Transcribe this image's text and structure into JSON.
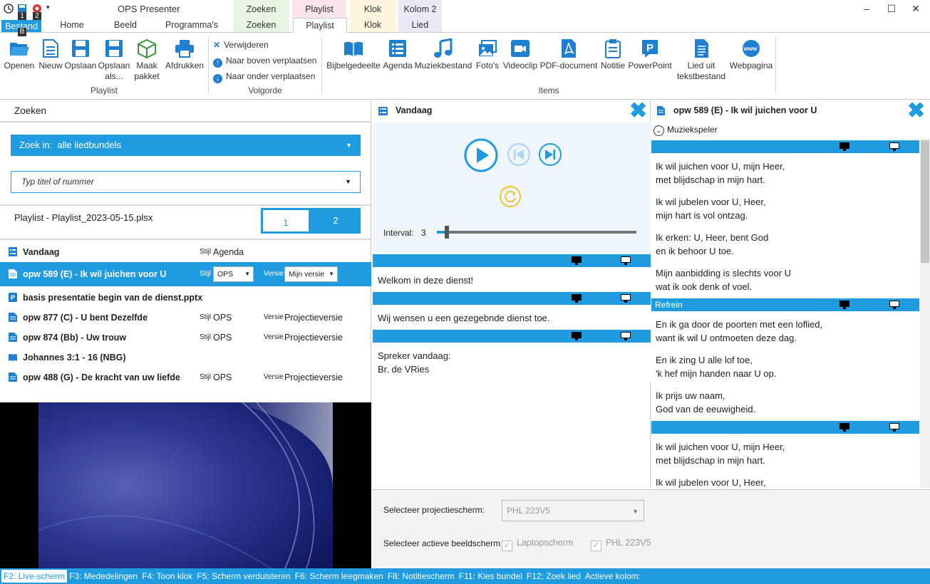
{
  "app": {
    "title": "OPS Presenter",
    "quick_access_badges": [
      "1",
      "2",
      "B"
    ]
  },
  "context_groups": [
    {
      "header": "Zoeken",
      "tab": "Zoeken",
      "color": "#e8f4e4"
    },
    {
      "header": "Playlist",
      "tab": "Playlist",
      "color": "#fce4ec"
    },
    {
      "header": "Klok",
      "tab": "Klok",
      "color": "#fdf6dd"
    },
    {
      "header": "Kolom 2",
      "tab": "Lied",
      "color": "#ece8f6"
    }
  ],
  "ribbon_tabs": {
    "bestand": "Bestand",
    "home": "Home",
    "beeld": "Beeld",
    "programmas": "Programma's"
  },
  "ribbon": {
    "playlist_group": {
      "label": "Playlist",
      "buttons": {
        "openen": "Openen",
        "nieuw": "Nieuw",
        "opslaan": "Opslaan",
        "opslaan_als_1": "Opslaan",
        "opslaan_als_2": "als...",
        "maak_pakket_1": "Maak",
        "maak_pakket_2": "pakket",
        "afdrukken": "Afdrukken"
      }
    },
    "volgorde_group": {
      "label": "Volgorde",
      "verwijderen": "Verwijderen",
      "naar_boven": "Naar boven verplaatsen",
      "naar_onder": "Naar onder verplaatsen"
    },
    "items_group": {
      "label": "Items",
      "bijbelgedeelte": "Bijbelgedeelte",
      "agenda": "Agenda",
      "muziekbestand": "Muziekbestand",
      "fotos": "Foto's",
      "videoclip": "Videoclip",
      "pdf": "PDF-document",
      "notitie": "Notitie",
      "powerpoint": "PowerPoint",
      "lied_tekst_1": "Lied uit",
      "lied_tekst_2": "tekstbestand",
      "webpagina": "Webpagina"
    }
  },
  "search": {
    "title": "Zoeken",
    "zoek_in_label": "Zoek in:",
    "zoek_in_value": "alle liedbundels",
    "placeholder": "Typ titel of nummer"
  },
  "playlist": {
    "title": "Playlist - Playlist_2023-05-15.plsx",
    "pages": [
      "1",
      "2"
    ],
    "stijl_label": "Stijl",
    "versie_label": "Versie",
    "rows": [
      {
        "icon": "agenda",
        "name": "Vandaag",
        "stijl": "Agenda",
        "versie": ""
      },
      {
        "icon": "song",
        "name": "opw 589 (E) - Ik wil juichen voor U",
        "stijl": "OPS",
        "versie": "Mijn versie"
      },
      {
        "icon": "powerpoint",
        "name": "basis presentatie begin van de dienst.pptx",
        "stijl": "",
        "versie": ""
      },
      {
        "icon": "song",
        "name": "opw 877 (C) - U bent Dezelfde",
        "stijl": "OPS",
        "versie": "Projectieversie"
      },
      {
        "icon": "song",
        "name": "opw 874 (Bb) - Uw trouw",
        "stijl": "OPS",
        "versie": "Projectieversie"
      },
      {
        "icon": "bible",
        "name": "Johannes 3:1 - 16 (NBG)",
        "stijl": "",
        "versie": ""
      },
      {
        "icon": "song",
        "name": "opw 488 (G) - De kracht van uw liefde",
        "stijl": "OPS",
        "versie": "Projectieversie"
      }
    ]
  },
  "agenda_panel": {
    "title": "Vandaag",
    "interval_label": "Interval:",
    "interval_value": "3",
    "interval_fraction": 0.02,
    "slides": [
      [
        "Welkom in deze dienst!"
      ],
      [
        "Wij wensen u een gezegebnde dienst toe."
      ],
      [
        "Spreker vandaag:",
        "Br. de VRies"
      ]
    ]
  },
  "song_panel": {
    "title": "opw 589 (E) - Ik wil juichen voor U",
    "muziekspeler": "Muziekspeler",
    "refrein": "Refrein",
    "verse1": [
      [
        "Ik wil juichen voor U, mijn Heer,",
        "met blijdschap in mijn hart."
      ],
      [
        "Ik wil jubelen voor U, Heer,",
        "mijn hart is vol ontzag."
      ],
      [
        "Ik erken: U, Heer, bent God",
        "en ik behoor U toe."
      ],
      [
        "Mijn aanbidding is slechts voor U",
        "wat ik ook denk of voel."
      ]
    ],
    "refrain": [
      [
        "En ik ga door de poorten met een loflied,",
        "want ik wil U ontmoeten deze dag."
      ],
      [
        "En ik zing U alle lof toe,",
        "'k hef mijn handen naar U op."
      ],
      [
        "Ik prijs uw naam,",
        "God van de eeuwigheid."
      ]
    ],
    "verse1b": [
      [
        "Ik wil juichen voor U, mijn Heer,",
        "met blijdschap in mijn hart."
      ],
      [
        "Ik wil jubelen voor U, Heer,",
        ""
      ]
    ]
  },
  "settings": {
    "projectiescherm_label": "Selecteer projectiescherm:",
    "projectiescherm_value": "PHL 223V5",
    "actieve_label": "Selecteer actieve beeldscherm",
    "laptopscherm": "Laptopscherm",
    "phl": "PHL 223V5"
  },
  "status": {
    "f2": "F2: Live-scherm",
    "f3": "F3: Mededelingen",
    "f4": "F4: Toon klok",
    "f5": "F5: Scherm verduisteren",
    "f6": "F6: Scherm leegmaken",
    "f8": "F8: Notitiescherm",
    "f11": "F11: Kies bundel",
    "f12": "F12: Zoek lied",
    "kolom": "Actieve kolom:"
  }
}
